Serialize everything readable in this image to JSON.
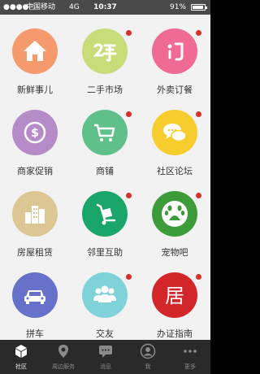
{
  "status_bar": {
    "signal": "●●●●○",
    "carrier": "中国移动",
    "network": "4G",
    "time": "10:37",
    "battery": "91%"
  },
  "tiles": [
    {
      "label": "新鲜事儿",
      "color": "#f59a6c",
      "icon": "house-icon",
      "badge": false
    },
    {
      "label": "二手市场",
      "color": "#c8dc7a",
      "icon": "secondhand-icon",
      "badge": true
    },
    {
      "label": "外卖订餐",
      "color": "#ef6a94",
      "icon": "takeout-icon",
      "badge": true
    },
    {
      "label": "商家促销",
      "color": "#b58cc8",
      "icon": "dollar-coin-icon",
      "badge": false
    },
    {
      "label": "商铺",
      "color": "#5fc08a",
      "icon": "shopping-cart-icon",
      "badge": true
    },
    {
      "label": "社区论坛",
      "color": "#f7cd2e",
      "icon": "chat-bubbles-icon",
      "badge": true
    },
    {
      "label": "房屋租赁",
      "color": "#dcc693",
      "icon": "buildings-icon",
      "badge": false
    },
    {
      "label": "邻里互助",
      "color": "#1aa56a",
      "icon": "hand-truck-icon",
      "badge": true
    },
    {
      "label": "宠物吧",
      "color": "#3d9c3a",
      "icon": "paw-icon",
      "badge": true
    },
    {
      "label": "拼车",
      "color": "#6672c9",
      "icon": "car-icon",
      "badge": false
    },
    {
      "label": "交友",
      "color": "#7fd2d8",
      "icon": "people-icon",
      "badge": true
    },
    {
      "label": "办证指南",
      "color": "#d3262b",
      "icon": "ju-character-icon",
      "icon_text": "居",
      "badge": true
    }
  ],
  "tab_bar": {
    "items": [
      {
        "label": "社区",
        "icon": "community-cube-icon",
        "active": true
      },
      {
        "label": "周边服务",
        "icon": "location-pin-icon",
        "active": false
      },
      {
        "label": "消息",
        "icon": "message-icon",
        "active": false
      },
      {
        "label": "我",
        "icon": "user-icon",
        "active": false
      },
      {
        "label": "更多",
        "icon": "more-dots-icon",
        "active": false
      }
    ]
  }
}
